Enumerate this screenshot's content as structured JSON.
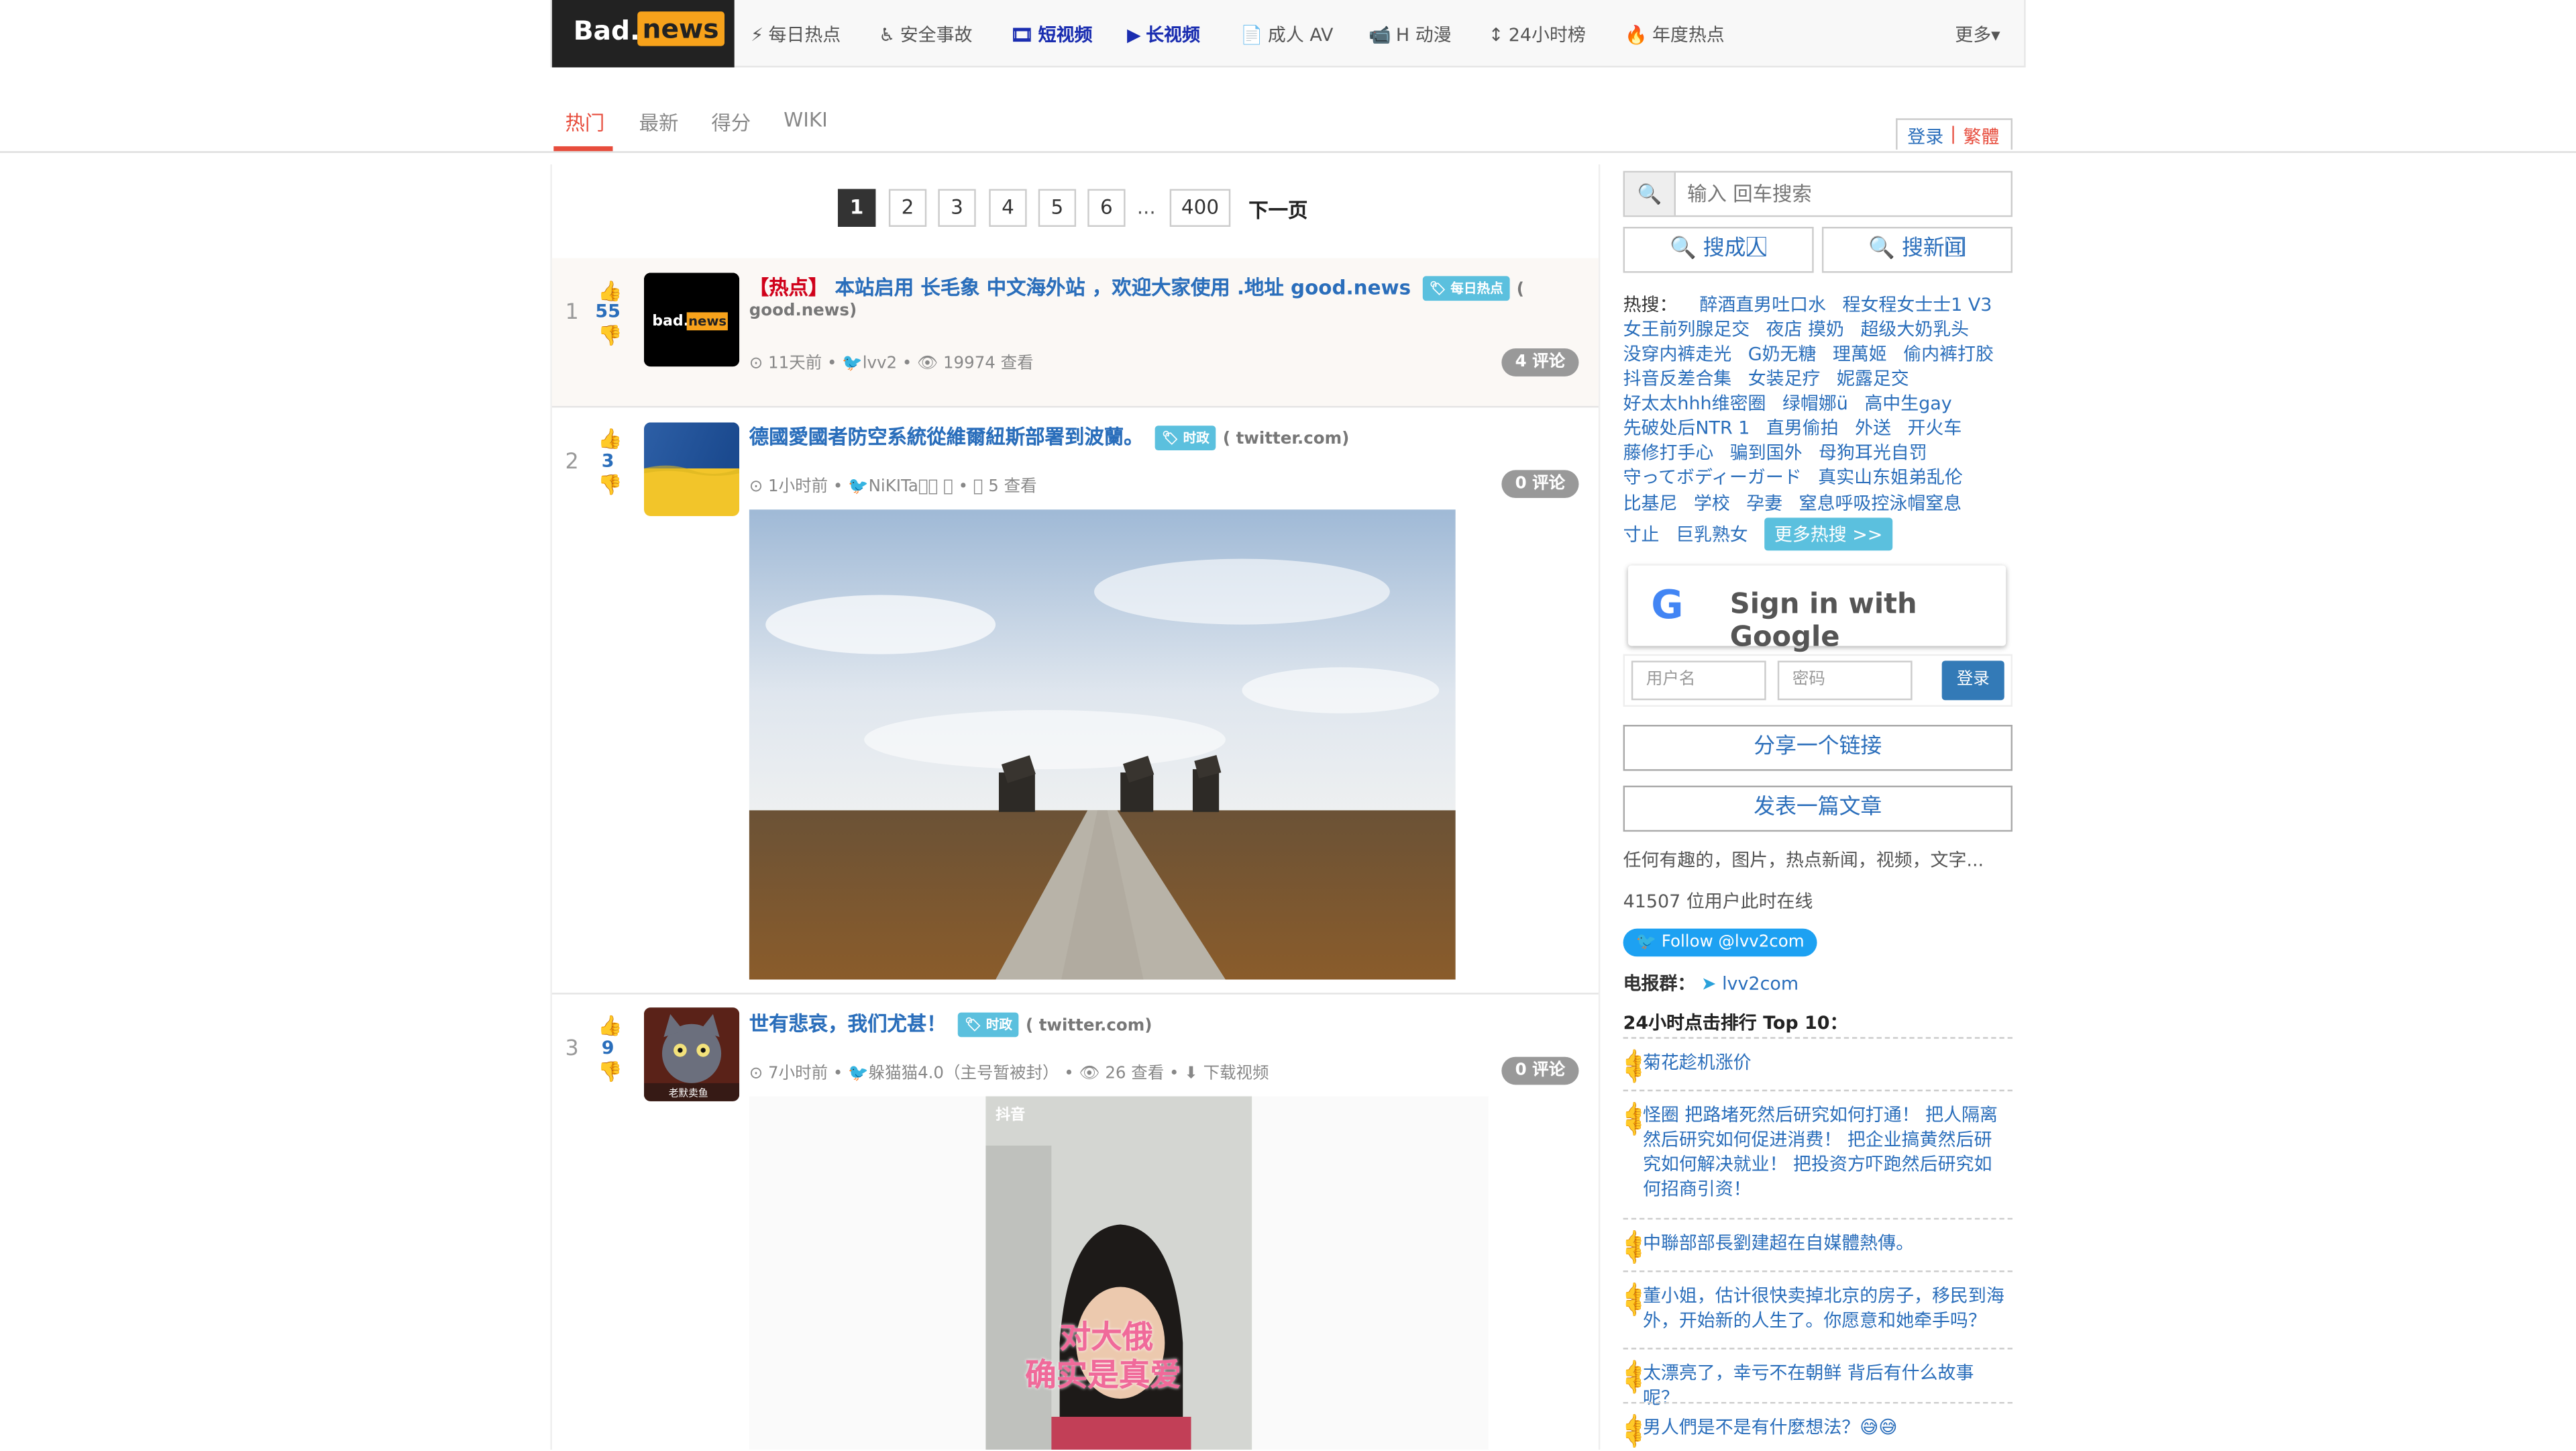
{
  "logo": {
    "bad": "Bad.",
    "news": "news"
  },
  "nav": [
    {
      "icon": "⚡",
      "label": "每日热点"
    },
    {
      "icon": "♿",
      "label": "安全事故"
    },
    {
      "icon": "🎞",
      "label": "短视频"
    },
    {
      "icon": "▶",
      "label": "长视频"
    },
    {
      "icon": "📄",
      "label": "成人 AV"
    },
    {
      "icon": "📹",
      "label": "H 动漫"
    },
    {
      "icon": "↕",
      "label": "24小时榜"
    },
    {
      "icon": "🔥",
      "label": "年度热点"
    },
    {
      "icon": "",
      "label": "更多▾"
    }
  ],
  "tabs": [
    "热门",
    "最新",
    "得分",
    "WIKI"
  ],
  "user_links": {
    "login": "登录",
    "sep": "|",
    "trad": "繁體"
  },
  "pagination": {
    "pages": [
      "1",
      "2",
      "3",
      "4",
      "5",
      "6"
    ],
    "dots": "...",
    "last": "400",
    "next": "下一页"
  },
  "posts": [
    {
      "rank": "1",
      "score": "55",
      "hot_prefix": "【热点】",
      "title": "本站启用 长毛象 中文海外站 ，欢迎大家使用 .地址 good.news",
      "tag": "每日热点",
      "domain_a": "(",
      "domain_b": "good.news)",
      "meta": "⊙ 11天前 • 🐦lvv2  • 👁 19974 查看",
      "comments": "4 评论"
    },
    {
      "rank": "2",
      "score": "3",
      "title": "德國愛國者防空系統從維爾紐斯部署到波蘭。",
      "tag": "时政",
      "domain": "( twitter.com)",
      "meta": "⊙ 1小时前 • 🐦NiKITa⃞⃞ ⃞  • 👁 5 查看",
      "comments": "0 评论"
    },
    {
      "rank": "3",
      "score": "9",
      "title": "世有悲哀，我们尤甚！",
      "tag": "时政",
      "domain": "( twitter.com)",
      "meta": "⊙ 7小时前 • 🐦躲猫猫4.0（主号暂被封）  • 👁 26 查看 • ⬇ 下载视频",
      "comments": "0 评论",
      "video_caption_1": "对大俄",
      "video_caption_2": "确实是真爱",
      "video_brand": "抖音",
      "thumb_label": "老默卖鱼"
    }
  ],
  "sidebar": {
    "search_placeholder": "输入 回车搜索",
    "search_people": "搜成人⃞",
    "search_news": "搜新闻⃞",
    "hot_label": "热搜：",
    "hot_lines": [
      [
        "醉酒直男吐口水",
        "程女程女士士1 V3"
      ],
      [
        "女王前列腺足交",
        "夜店 摸奶",
        "超级大奶乳头"
      ],
      [
        "没穿内裤走光",
        "G奶无糖",
        "理萬姬",
        "偷内裤打胶"
      ],
      [
        "抖音反差合集",
        "女装足疗",
        "妮露足交"
      ],
      [
        "好太太hhh维密圈",
        "绿帽娜ü",
        "高中生gay"
      ],
      [
        "先破处后NTR 1",
        "直男偷拍",
        "外送",
        "开火车"
      ],
      [
        "藤修打手心",
        "骗到国外",
        "母狗耳光自罚"
      ],
      [
        "守ってボディーガード",
        "真实山东姐弟乱伦"
      ],
      [
        "比基尼",
        "学校",
        "孕妻",
        "窒息呼吸控泳帽窒息"
      ],
      [
        "寸止",
        "巨乳熟女"
      ]
    ],
    "more_hot": "更多热搜 >>",
    "google": "Sign in with Google",
    "username_ph": "用户名",
    "password_ph": "密码",
    "login_btn": "登录",
    "share_link": "分享一个链接",
    "post_article": "发表一篇文章",
    "desc": "任何有趣的，图片，热点新闻，视频，文字...",
    "online": "41507 位用户此时在线",
    "twitter": "🐦 Follow @lvv2com",
    "telegram_label": "电报群：",
    "telegram": "lvv2com",
    "top10_title": "24小时点击排行 Top 10：",
    "top10": [
      "菊花趁机涨价",
      "怪圈 把路堵死然后研究如何打通！ 把人隔离然后研究如何促进消费！ 把企业搞黄然后研究如何解决就业！ 把投资方吓跑然后研究如何招商引资！",
      "中聯部部長劉建超在自媒體熱傳。",
      "董小姐，估计很快卖掉北京的房子，移民到海外，开始新的人生了。你愿意和她牵手吗？",
      "太漂亮了，幸亏不在朝鲜 背后有什么故事呢？",
      "男人們是不是有什麼想法？😅😅"
    ]
  },
  "colors": {
    "accent": "#2a6ebb",
    "hot_red": "#d0021b",
    "tag": "#5bc0de",
    "logo_orange": "#f7a21b"
  }
}
